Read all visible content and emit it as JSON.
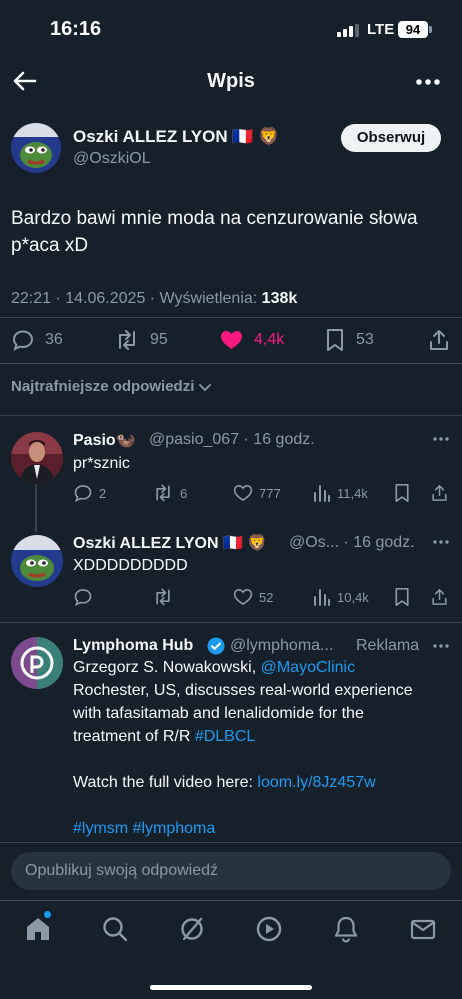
{
  "status_bar": {
    "time": "16:16",
    "network": "LTE",
    "battery": "94"
  },
  "header": {
    "title": "Wpis",
    "back_icon": "arrow-left-icon",
    "more_icon": "more-horizontal-icon"
  },
  "post": {
    "author_name": "Oszki ALLEZ LYON 🇫🇷 🦁",
    "author_handle": "@OszkiOL",
    "follow_label": "Obserwuj",
    "text": "Bardzo bawi mnie moda na cenzurowanie słowa p*aca xD",
    "time": "22:21 · 14.06.2025 · Wyświetlenia: ",
    "views": "138k",
    "stats": {
      "replies": "36",
      "reposts": "95",
      "likes": "4,4k",
      "bookmarks": "53"
    },
    "liked": true
  },
  "sort": {
    "label": "Najtrafniejsze odpowiedzi"
  },
  "replies": [
    {
      "name": "Pasio🦦",
      "handle": "@pasio_067 · 16 godz.",
      "text": "pr*sznic",
      "stats": {
        "replies": "2",
        "reposts": "6",
        "likes": "777",
        "views": "11,4k"
      }
    },
    {
      "name": "Oszki ALLEZ LYON 🇫🇷 🦁",
      "handle": "@Os... · 16 godz.",
      "text": "XDDDDDDDDD",
      "stats": {
        "replies": "",
        "reposts": "",
        "likes": "52",
        "views": "10,4k"
      }
    }
  ],
  "ad": {
    "name": "Lymphoma Hub",
    "handle": "@lymphoma...",
    "label": "Reklama",
    "line1_pre": "Grzegorz S. Nowakowski, ",
    "mention": "@MayoClinic",
    "line2": "Rochester, US, discusses real-world experience with tafasitamab and lenalidomide for the treatment of R/R ",
    "hashtag": "#DLBCL",
    "cta_pre": "Watch the full video here: ",
    "cta_link": "loom.ly/8Jz457w",
    "tags": "#lymsm #lymphoma"
  },
  "reply_input": {
    "placeholder": "Opublikuj swoją odpowiedź"
  },
  "colors": {
    "background": "#15202b",
    "accent": "#1d9bf0",
    "like": "#f91880",
    "muted": "#8b98a5"
  },
  "nav": [
    "home-icon",
    "search-icon",
    "grok-icon",
    "video-icon",
    "bell-icon",
    "mail-icon"
  ]
}
